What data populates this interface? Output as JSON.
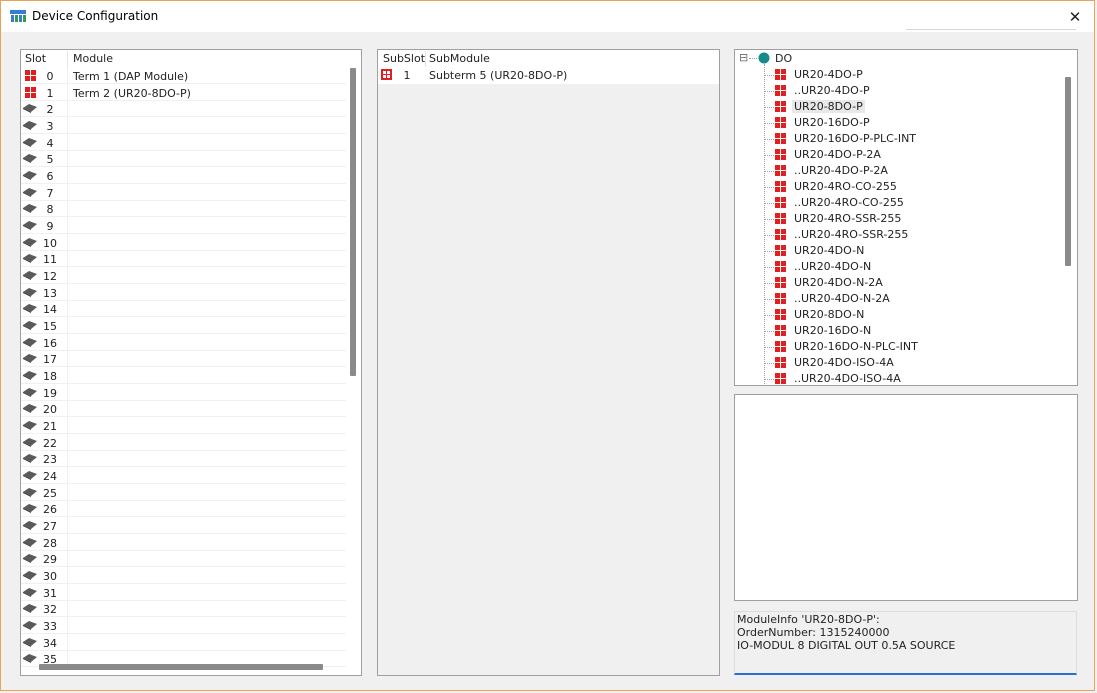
{
  "window": {
    "title": "Device Configuration",
    "close_label": "✕"
  },
  "slots": {
    "headers": {
      "slot": "Slot",
      "module": "Module"
    },
    "rows": [
      {
        "slot": "0",
        "module": "Term 1 (DAP Module)",
        "icon": "module-icon"
      },
      {
        "slot": "1",
        "module": "Term 2 (UR20-8DO-P)",
        "icon": "module-icon"
      },
      {
        "slot": "2",
        "module": "",
        "icon": "empty-slot-icon"
      },
      {
        "slot": "3",
        "module": "",
        "icon": "empty-slot-icon"
      },
      {
        "slot": "4",
        "module": "",
        "icon": "empty-slot-icon"
      },
      {
        "slot": "5",
        "module": "",
        "icon": "empty-slot-icon"
      },
      {
        "slot": "6",
        "module": "",
        "icon": "empty-slot-icon"
      },
      {
        "slot": "7",
        "module": "",
        "icon": "empty-slot-icon"
      },
      {
        "slot": "8",
        "module": "",
        "icon": "empty-slot-icon"
      },
      {
        "slot": "9",
        "module": "",
        "icon": "empty-slot-icon"
      },
      {
        "slot": "10",
        "module": "",
        "icon": "empty-slot-icon"
      },
      {
        "slot": "11",
        "module": "",
        "icon": "empty-slot-icon"
      },
      {
        "slot": "12",
        "module": "",
        "icon": "empty-slot-icon"
      },
      {
        "slot": "13",
        "module": "",
        "icon": "empty-slot-icon"
      },
      {
        "slot": "14",
        "module": "",
        "icon": "empty-slot-icon"
      },
      {
        "slot": "15",
        "module": "",
        "icon": "empty-slot-icon"
      },
      {
        "slot": "16",
        "module": "",
        "icon": "empty-slot-icon"
      },
      {
        "slot": "17",
        "module": "",
        "icon": "empty-slot-icon"
      },
      {
        "slot": "18",
        "module": "",
        "icon": "empty-slot-icon"
      },
      {
        "slot": "19",
        "module": "",
        "icon": "empty-slot-icon"
      },
      {
        "slot": "20",
        "module": "",
        "icon": "empty-slot-icon"
      },
      {
        "slot": "21",
        "module": "",
        "icon": "empty-slot-icon"
      },
      {
        "slot": "22",
        "module": "",
        "icon": "empty-slot-icon"
      },
      {
        "slot": "23",
        "module": "",
        "icon": "empty-slot-icon"
      },
      {
        "slot": "24",
        "module": "",
        "icon": "empty-slot-icon"
      },
      {
        "slot": "25",
        "module": "",
        "icon": "empty-slot-icon"
      },
      {
        "slot": "26",
        "module": "",
        "icon": "empty-slot-icon"
      },
      {
        "slot": "27",
        "module": "",
        "icon": "empty-slot-icon"
      },
      {
        "slot": "28",
        "module": "",
        "icon": "empty-slot-icon"
      },
      {
        "slot": "29",
        "module": "",
        "icon": "empty-slot-icon"
      },
      {
        "slot": "30",
        "module": "",
        "icon": "empty-slot-icon"
      },
      {
        "slot": "31",
        "module": "",
        "icon": "empty-slot-icon"
      },
      {
        "slot": "32",
        "module": "",
        "icon": "empty-slot-icon"
      },
      {
        "slot": "33",
        "module": "",
        "icon": "empty-slot-icon"
      },
      {
        "slot": "34",
        "module": "",
        "icon": "empty-slot-icon"
      },
      {
        "slot": "35",
        "module": "",
        "icon": "empty-slot-icon"
      }
    ]
  },
  "subslots": {
    "headers": {
      "subslot": "SubSlot",
      "submodule": "SubModule"
    },
    "rows": [
      {
        "subslot": "1",
        "submodule": "Subterm 5 (UR20-8DO-P)",
        "icon": "submodule-icon"
      }
    ]
  },
  "catalog": {
    "root": {
      "label": "DO",
      "expander": "⊟"
    },
    "items": [
      {
        "label": "UR20-4DO-P"
      },
      {
        "label": "..UR20-4DO-P"
      },
      {
        "label": "UR20-8DO-P",
        "selected": true
      },
      {
        "label": "UR20-16DO-P"
      },
      {
        "label": "UR20-16DO-P-PLC-INT"
      },
      {
        "label": "UR20-4DO-P-2A"
      },
      {
        "label": "..UR20-4DO-P-2A"
      },
      {
        "label": "UR20-4RO-CO-255"
      },
      {
        "label": "..UR20-4RO-CO-255"
      },
      {
        "label": "UR20-4RO-SSR-255"
      },
      {
        "label": "..UR20-4RO-SSR-255"
      },
      {
        "label": "UR20-4DO-N"
      },
      {
        "label": "..UR20-4DO-N"
      },
      {
        "label": "UR20-4DO-N-2A"
      },
      {
        "label": "..UR20-4DO-N-2A"
      },
      {
        "label": "UR20-8DO-N"
      },
      {
        "label": "UR20-16DO-N"
      },
      {
        "label": "UR20-16DO-N-PLC-INT"
      },
      {
        "label": "UR20-4DO-ISO-4A"
      },
      {
        "label": "..UR20-4DO-ISO-4A"
      }
    ]
  },
  "module_info": {
    "line1": "ModuleInfo 'UR20-8DO-P':",
    "line2": "OrderNumber: 1315240000",
    "line3": "IO-MODUL 8 DIGITAL OUT 0.5A SOURCE"
  },
  "colors": {
    "accent": "#2a6fd0",
    "module_red": "#e02020",
    "root_node": "#178a8a",
    "window_border": "#e8a25a"
  }
}
